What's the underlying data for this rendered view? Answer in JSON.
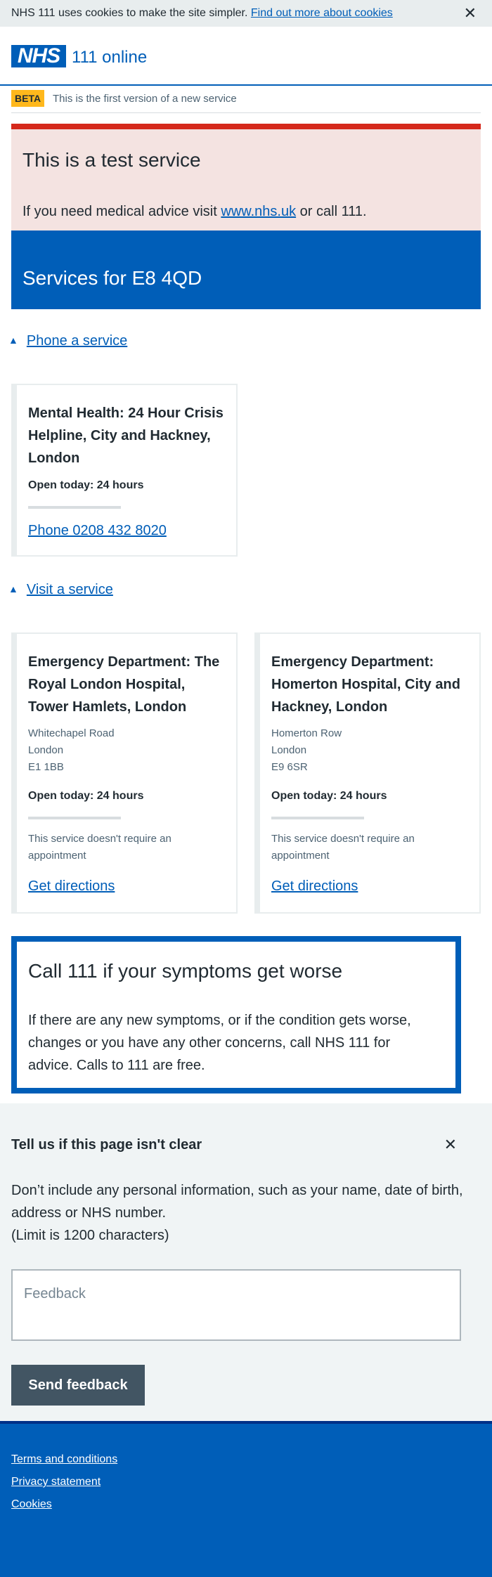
{
  "cookie_banner": {
    "text": "NHS 111 uses cookies to make the site simpler.",
    "link_text": "Find out more about cookies",
    "close_symbol": "✕"
  },
  "header": {
    "logo_text": "NHS",
    "site_name": "111 online"
  },
  "beta": {
    "tag": "BETA",
    "text": "This is the first version of a new service"
  },
  "test_banner": {
    "title": "This is a test service",
    "message_prefix": "If you need medical advice visit",
    "link_text": "www.nhs.uk",
    "message_suffix": "or call 111."
  },
  "services": {
    "title": "Services for E8 4QD"
  },
  "phone_section": {
    "toggle_label": "Phone a service",
    "cards": [
      {
        "title": "Mental Health: 24 Hour Crisis Helpline, City and Hackney, London",
        "open_today": "Open today: 24 hours",
        "link": "Phone 0208 432 8020"
      }
    ]
  },
  "visit_section": {
    "toggle_label": "Visit a service",
    "cards": [
      {
        "title": "Emergency Department: The Royal London Hospital, Tower Hamlets, London",
        "address": [
          "Whitechapel Road",
          "London",
          "E1 1BB"
        ],
        "open_today": "Open today: 24 hours",
        "note": "This service doesn't require an appointment",
        "link": "Get directions"
      },
      {
        "title": "Emergency Department: Homerton Hospital, City and Hackney, London",
        "address": [
          "Homerton Row",
          "London",
          "E9 6SR"
        ],
        "open_today": "Open today: 24 hours",
        "note": "This service doesn't require an appointment",
        "link": "Get directions"
      }
    ]
  },
  "care_card": {
    "title": "Call 111 if your symptoms get worse",
    "text": "If there are any new symptoms, or if the condition gets worse, changes or you have any other concerns, call NHS 111 for advice. Calls to 111 are free."
  },
  "feedback": {
    "heading": "Tell us if this page isn't clear",
    "close_symbol": "✕",
    "description": "Don’t include any personal information, such as your name, date of birth, address or NHS number.",
    "limit": "(Limit is 1200 characters)",
    "placeholder": "Feedback",
    "button": "Send feedback"
  },
  "footer": {
    "links": [
      "Terms and conditions",
      "Privacy statement",
      "Cookies"
    ]
  },
  "colors": {
    "nhs_blue": "#005eb8",
    "emergency_red": "#d5281b",
    "warm_yellow": "#ffb81c",
    "pale_grey": "#f0f4f5",
    "dark_grey": "#425563"
  },
  "icons": {
    "section_toggle": "triangle-up-icon",
    "close": "close-icon"
  }
}
